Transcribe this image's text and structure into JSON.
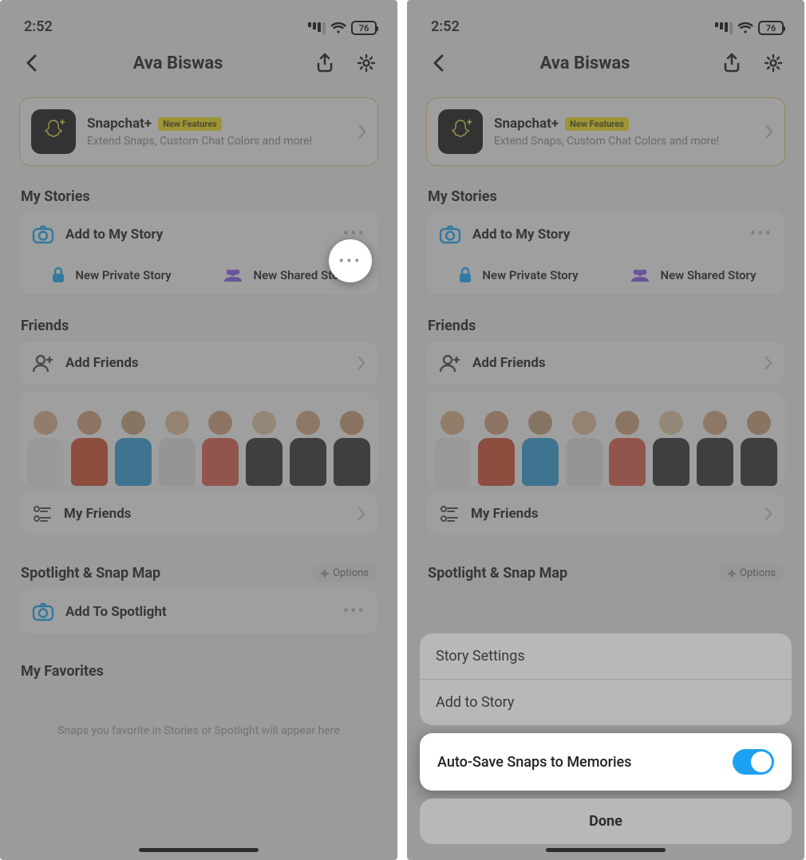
{
  "status": {
    "time": "2:52",
    "battery": "76"
  },
  "header": {
    "title": "Ava Biswas"
  },
  "promo": {
    "title": "Snapchat+",
    "badge": "New Features",
    "sub": "Extend Snaps, Custom Chat Colors and more!"
  },
  "sections": {
    "my_stories": "My Stories",
    "friends": "Friends",
    "spotlight": "Spotlight & Snap Map",
    "favorites": "My Favorites"
  },
  "stories": {
    "add_my_story": "Add to My Story",
    "new_private": "New Private Story",
    "new_shared": "New Shared Story"
  },
  "friends": {
    "add": "Add Friends",
    "my": "My Friends"
  },
  "spotlight": {
    "options": "Options",
    "add": "Add To Spotlight"
  },
  "favorites_hint": "Snaps you favorite in Stories or Spotlight will appear here",
  "sheet": {
    "settings": "Story Settings",
    "add": "Add to Story",
    "autosave": "Auto-Save Snaps to Memories",
    "done": "Done",
    "toggle_on": true
  },
  "avatar_colors": [
    {
      "skin": "#e0b48a",
      "shirt": "#f2f2f2"
    },
    {
      "skin": "#d9a178",
      "shirt": "#d84b2b"
    },
    {
      "skin": "#caa27a",
      "shirt": "#2aa0dd"
    },
    {
      "skin": "#e6c29a",
      "shirt": "#e8e8e8"
    },
    {
      "skin": "#d49f78",
      "shirt": "#e35b4a"
    },
    {
      "skin": "#e8c9a6",
      "shirt": "#2b2b2b"
    },
    {
      "skin": "#d8a884",
      "shirt": "#2b2b2b"
    },
    {
      "skin": "#cfa178",
      "shirt": "#2b2b2b"
    }
  ]
}
